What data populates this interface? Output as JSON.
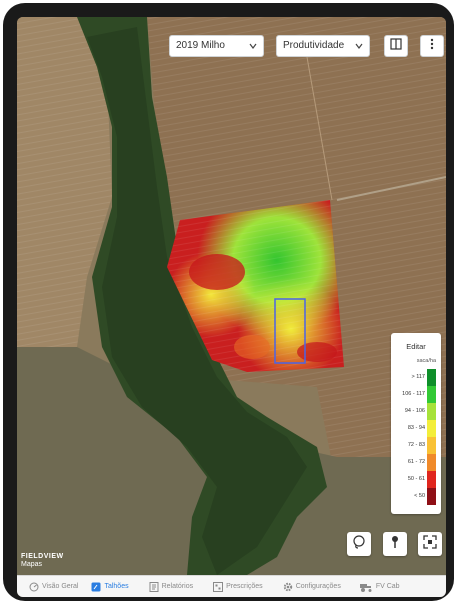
{
  "filters": {
    "season": "2019 Milho",
    "layer": "Produtividade"
  },
  "legend": {
    "edit_label": "Editar",
    "unit": "saca/ha",
    "items": [
      {
        "label": "> 117",
        "color": "#0f8f2a"
      },
      {
        "label": "106 - 117",
        "color": "#32c935"
      },
      {
        "label": "94 - 106",
        "color": "#a7e23a"
      },
      {
        "label": "83 - 94",
        "color": "#f3ee3a"
      },
      {
        "label": "72 - 83",
        "color": "#f9c235"
      },
      {
        "label": "61 - 72",
        "color": "#f08a2a"
      },
      {
        "label": "50 - 61",
        "color": "#e0261e"
      },
      {
        "label": "< 50",
        "color": "#8e0f16"
      }
    ]
  },
  "branding": {
    "fieldview": "FIELDVIEW",
    "maps": "Mapas"
  },
  "tabs": [
    {
      "label": "Visão Geral",
      "icon": "gauge-icon",
      "active": false
    },
    {
      "label": "Talhões",
      "icon": "field-icon",
      "active": true
    },
    {
      "label": "Relatórios",
      "icon": "report-icon",
      "active": false
    },
    {
      "label": "Prescrições",
      "icon": "prescription-icon",
      "active": false
    },
    {
      "label": "Configurações",
      "icon": "gear-icon",
      "active": false
    },
    {
      "label": "FV Cab",
      "icon": "tractor-icon",
      "active": false
    }
  ]
}
